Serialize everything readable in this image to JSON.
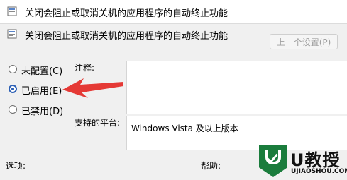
{
  "window": {
    "title": "关闭会阻止或取消关机的应用程序的自动终止功能",
    "icon": "policy-icon"
  },
  "header": {
    "title": "关闭会阻止或取消关机的应用程序的自动终止功能",
    "icon": "policy-icon",
    "prev_button_label": "上一个设置(P)"
  },
  "options": [
    {
      "label": "未配置(C)",
      "selected": false
    },
    {
      "label": "已启用(E)",
      "selected": true
    },
    {
      "label": "已禁用(D)",
      "selected": false
    }
  ],
  "comment": {
    "label": "注释:",
    "value": ""
  },
  "platform": {
    "label": "支持的平台:",
    "value": "Windows Vista 及以上版本"
  },
  "footer": {
    "options_label": "选项:",
    "help_label": "帮助:"
  },
  "watermark": {
    "brand": "U教授",
    "url": "UJIAOSHOU.COM"
  },
  "colors": {
    "arrow": "#e53935",
    "radio_selected": "#2b5fb5",
    "watermark_green": "#1a7c3c"
  }
}
